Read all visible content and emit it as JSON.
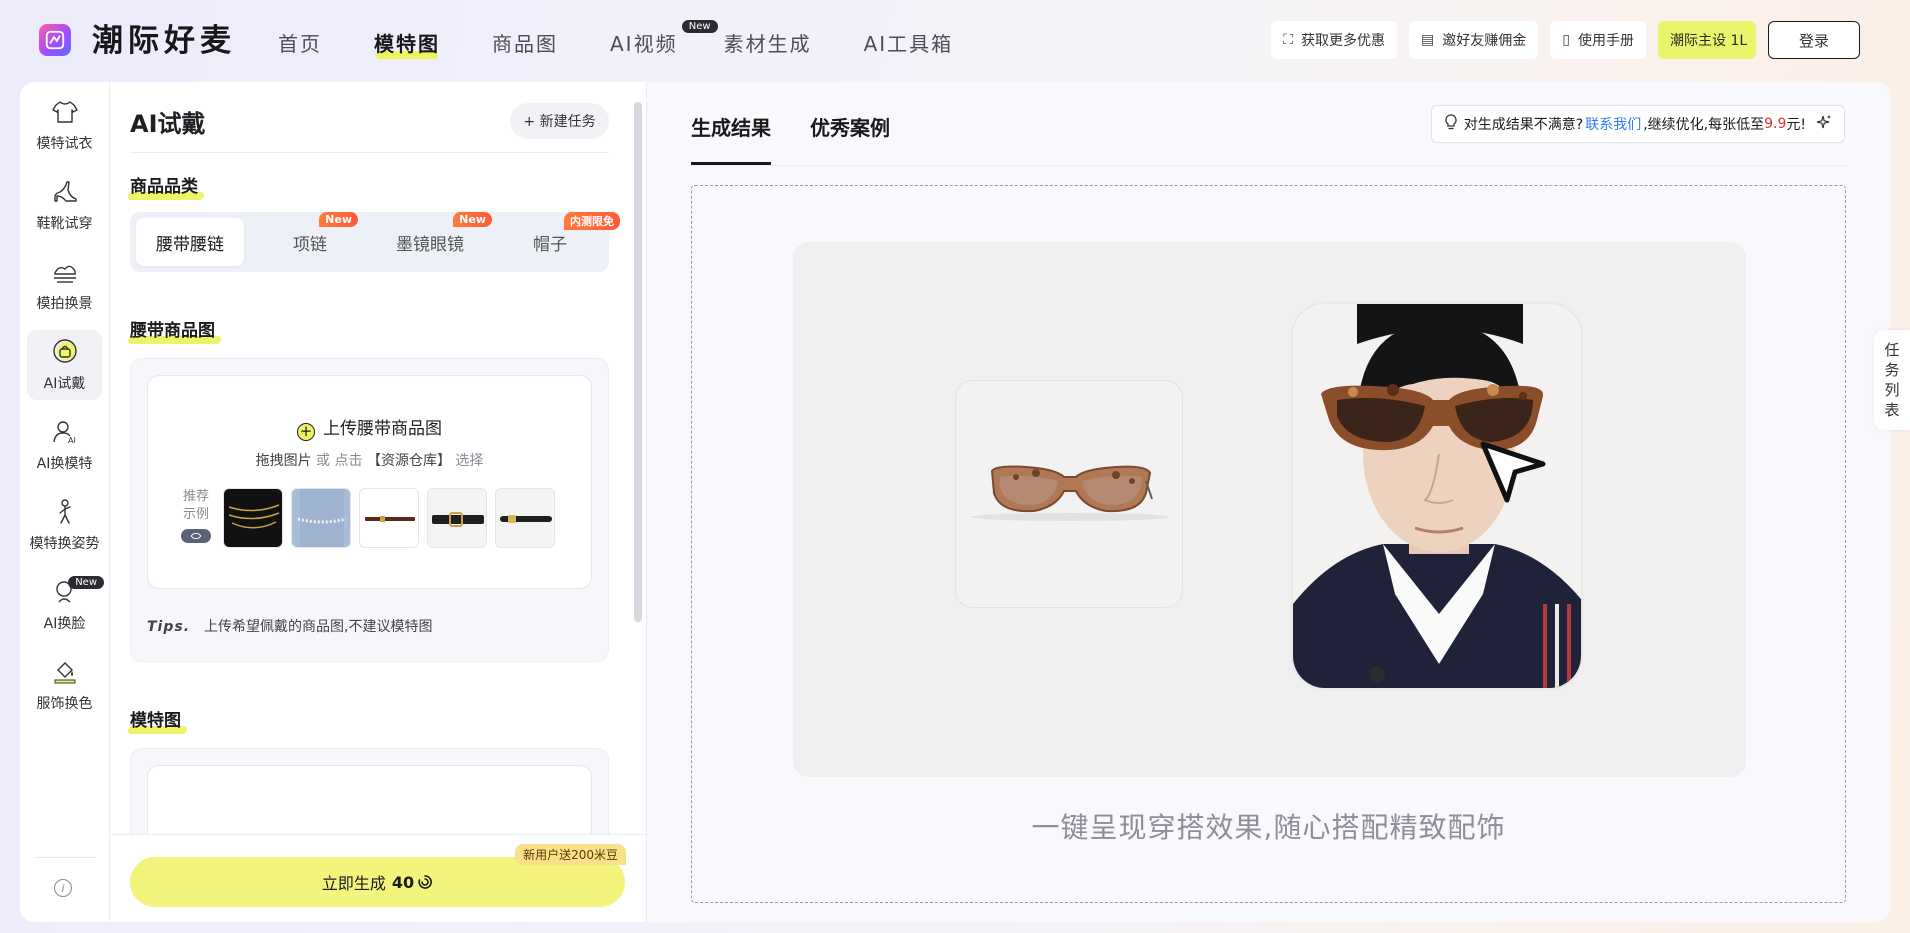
{
  "app": {
    "name": "潮际好麦"
  },
  "nav": {
    "items": [
      {
        "label": "首页"
      },
      {
        "label": "模特图",
        "active": true
      },
      {
        "label": "商品图"
      },
      {
        "label": "AI视频",
        "tag": "New"
      },
      {
        "label": "素材生成"
      },
      {
        "label": "AI工具箱"
      }
    ]
  },
  "top_actions": {
    "offers": "获取更多优惠",
    "invite": "邀好友赚佣金",
    "manual": "使用手册",
    "theme": "潮际主设 1L",
    "login": "登录"
  },
  "rail": {
    "items": [
      {
        "label": "模特试衣",
        "icon": "tshirt-icon"
      },
      {
        "label": "鞋靴试穿",
        "icon": "high-heel-icon"
      },
      {
        "label": "模拍换景",
        "icon": "scene-icon"
      },
      {
        "label": "AI试戴",
        "icon": "accessory-icon",
        "active": true
      },
      {
        "label": "AI换模特",
        "icon": "ai-model-icon"
      },
      {
        "label": "模特换姿势",
        "icon": "pose-icon"
      },
      {
        "label": "AI换脸",
        "icon": "face-swap-icon",
        "tag": "New"
      },
      {
        "label": "服饰换色",
        "icon": "paint-bucket-icon"
      }
    ],
    "info_icon": "info-icon"
  },
  "panel": {
    "title": "AI试戴",
    "new_task": "+ 新建任务",
    "category_heading": "商品品类",
    "categories": [
      {
        "label": "腰带腰链",
        "active": true
      },
      {
        "label": "项链",
        "badge": "New"
      },
      {
        "label": "墨镜眼镜",
        "badge": "New"
      },
      {
        "label": "帽子",
        "badge": "内测限免"
      }
    ],
    "product_heading": "腰带商品图",
    "upload": {
      "title": "上传腰带商品图",
      "drag": "拖拽图片",
      "or": "或",
      "click": "点击",
      "repo": "【资源仓库】",
      "choose": "选择",
      "sample_label": "推荐示例"
    },
    "tips_label": "Tips.",
    "tips_text": "上传希望佩戴的商品图,不建议模特图",
    "model_heading": "模特图",
    "promo": "新用户送200米豆",
    "generate_label": "立即生成",
    "generate_cost": "40"
  },
  "result": {
    "tabs": [
      {
        "label": "生成结果",
        "active": true
      },
      {
        "label": "优秀案例"
      }
    ],
    "notice": {
      "prefix": "对生成结果不满意?",
      "link": "联系我们",
      "middle": ",继续优化,每张低至",
      "price": "9.9",
      "suffix": "元!"
    },
    "slogan": "一键呈现穿搭效果,随心搭配精致配饰",
    "task_list": "任务列表"
  },
  "colors": {
    "accent_yellow": "#eef46a",
    "link_blue": "#2f7cf6",
    "price_red": "#e0312b"
  }
}
